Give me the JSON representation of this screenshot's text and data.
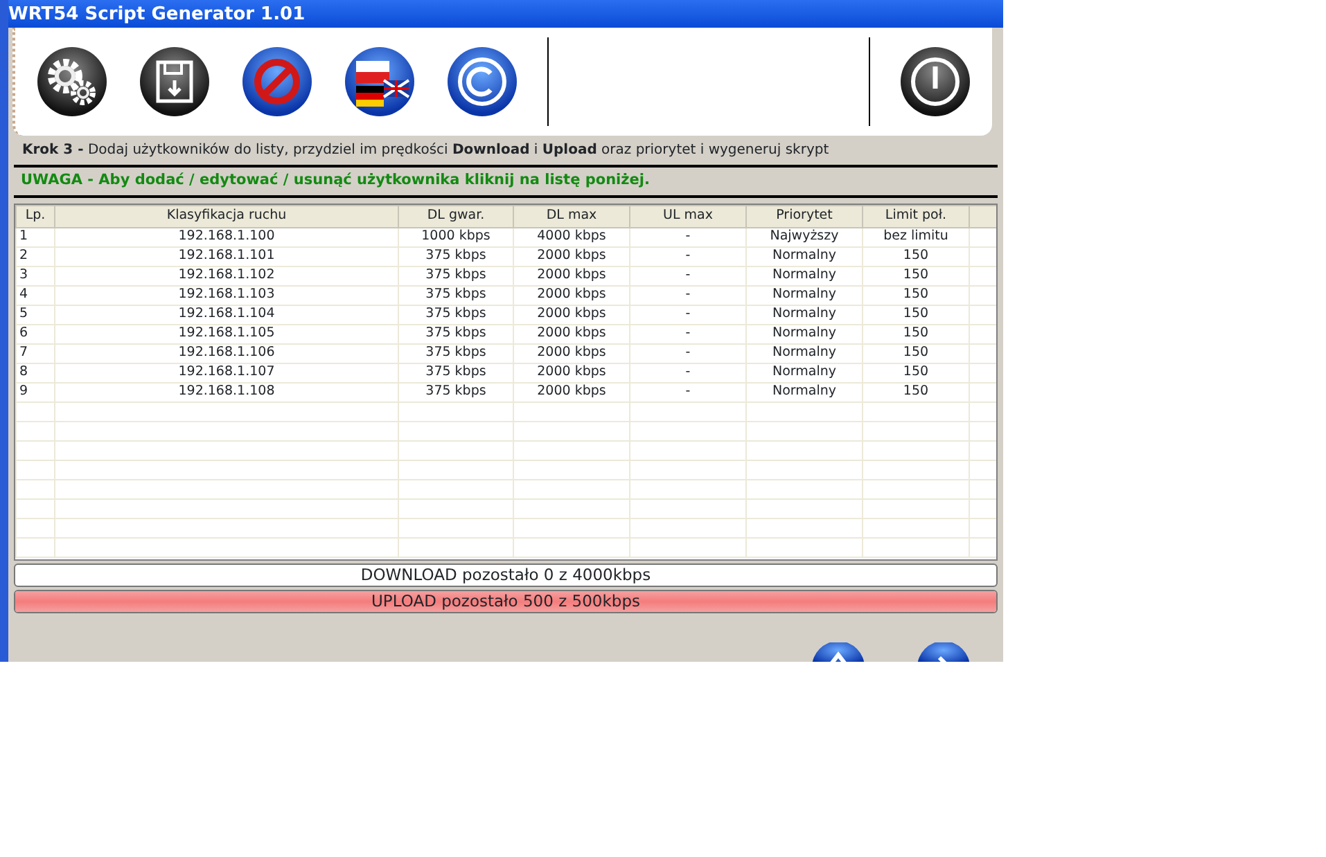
{
  "window": {
    "title": "WRT54 Script Generator 1.01"
  },
  "toolbar": [
    {
      "kind": "gears"
    },
    {
      "kind": "save"
    },
    {
      "kind": "forbid"
    },
    {
      "kind": "flags"
    },
    {
      "kind": "copyright"
    }
  ],
  "power": {
    "kind": "power"
  },
  "step": "**Krok 3 -** Dodaj użytkowników do listy, przydziel im prędkości **Download** i **Upload** oraz priorytet i wygeneruj skrypt",
  "warning": "UWAGA - Aby dodać / edytować / usunąć użytkownika kliknij na listę poniżej.",
  "table": {
    "columns": [
      "Lp.",
      "Klasyfikacja ruchu",
      "DL gwar.",
      "DL max",
      "UL max",
      "Priorytet",
      "Limit poł."
    ],
    "rows": [
      [
        "1",
        "192.168.1.100",
        "1000 kbps",
        "4000 kbps",
        "-",
        "Najwyższy",
        "bez limitu"
      ],
      [
        "2",
        "192.168.1.101",
        "375 kbps",
        "2000 kbps",
        "-",
        "Normalny",
        "150"
      ],
      [
        "3",
        "192.168.1.102",
        "375 kbps",
        "2000 kbps",
        "-",
        "Normalny",
        "150"
      ],
      [
        "4",
        "192.168.1.103",
        "375 kbps",
        "2000 kbps",
        "-",
        "Normalny",
        "150"
      ],
      [
        "5",
        "192.168.1.104",
        "375 kbps",
        "2000 kbps",
        "-",
        "Normalny",
        "150"
      ],
      [
        "6",
        "192.168.1.105",
        "375 kbps",
        "2000 kbps",
        "-",
        "Normalny",
        "150"
      ],
      [
        "7",
        "192.168.1.106",
        "375 kbps",
        "2000 kbps",
        "-",
        "Normalny",
        "150"
      ],
      [
        "8",
        "192.168.1.107",
        "375 kbps",
        "2000 kbps",
        "-",
        "Normalny",
        "150"
      ],
      [
        "9",
        "192.168.1.108",
        "375 kbps",
        "2000 kbps",
        "-",
        "Normalny",
        "150"
      ]
    ]
  },
  "meters": [
    {
      "label": "DOWNLOAD pozostało 0 z 4000kbps",
      "level": 0
    },
    {
      "label": "UPLOAD pozostało 500 z 500kbps",
      "level": 1
    }
  ],
  "nav_buttons": [
    {
      "kind": "up"
    },
    {
      "kind": "next"
    }
  ]
}
